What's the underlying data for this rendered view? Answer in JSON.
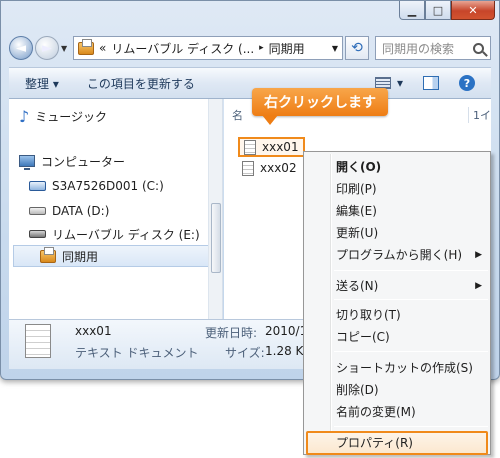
{
  "window": {
    "minimize": "▁",
    "maximize": "□",
    "close": "✕"
  },
  "nav": {
    "back_glyph": "◄",
    "forward_glyph": "►",
    "history_glyph": "▼",
    "address": {
      "prefix": "«",
      "segment1": "リムーバブル ディスク (...",
      "sep": "▸",
      "segment2": "同期用",
      "dropdown": "▼"
    },
    "refresh_glyph": "⟲",
    "search_placeholder": "同期用の検索"
  },
  "toolbar": {
    "organize": "整理 ▾",
    "update": "この項目を更新する",
    "view_dropdown": "▾",
    "help": "?"
  },
  "sidebar": {
    "music": "ミュージック",
    "computer": "コンピューター",
    "drive_c": "S3A7526D001 (C:)",
    "drive_d": "DATA (D:)",
    "drive_e": "リムーバブル ディスク (E:)",
    "sync_folder": "同期用"
  },
  "content": {
    "header_name": "名",
    "header_right": "1イ",
    "files": [
      "xxx01",
      "xxx02"
    ]
  },
  "details": {
    "name": "xxx01",
    "type": "テキスト ドキュメント",
    "modified_label": "更新日時:",
    "modified_value": "2010/1",
    "size_label": "サイズ:",
    "size_value": "1.28 K"
  },
  "callout": "右クリックします",
  "context_menu": [
    {
      "label": "開く(O)",
      "bold": true
    },
    {
      "label": "印刷(P)"
    },
    {
      "label": "編集(E)"
    },
    {
      "label": "更新(U)"
    },
    {
      "label": "プログラムから開く(H)",
      "submenu": true
    },
    {
      "label": "送る(N)",
      "submenu": true
    },
    {
      "label": "切り取り(T)"
    },
    {
      "label": "コピー(C)"
    },
    {
      "label": "ショートカットの作成(S)"
    },
    {
      "label": "削除(D)"
    },
    {
      "label": "名前の変更(M)"
    },
    {
      "label": "プロパティ(R)",
      "highlighted": true
    }
  ],
  "accent_color": "#f08a1b"
}
